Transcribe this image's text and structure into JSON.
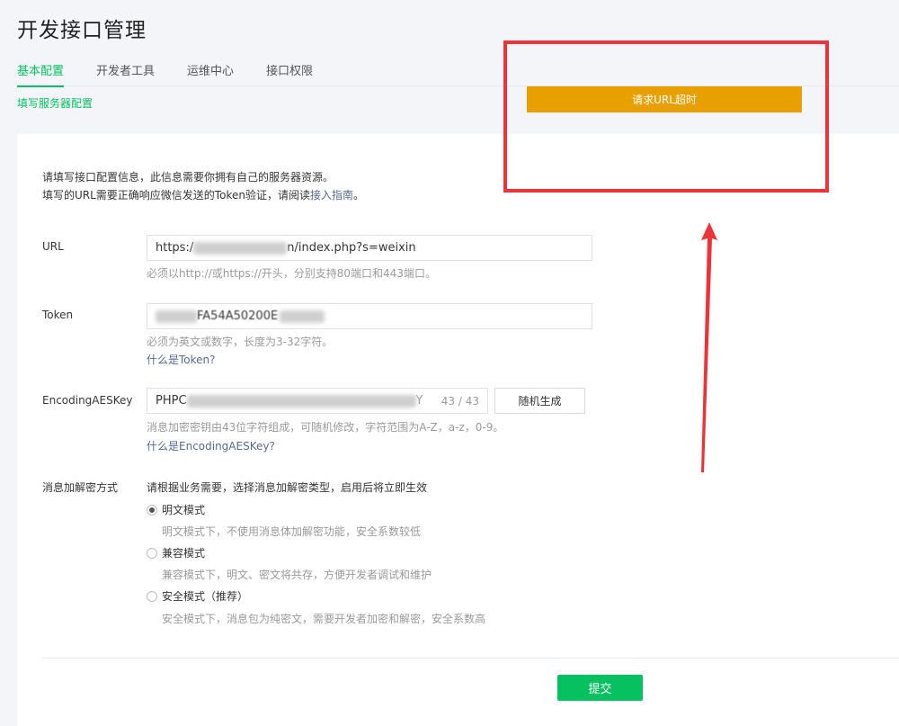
{
  "page": {
    "title": "开发接口管理"
  },
  "tabs": [
    {
      "label": "基本配置",
      "active": true
    },
    {
      "label": "开发者工具",
      "active": false
    },
    {
      "label": "运维中心",
      "active": false
    },
    {
      "label": "接口权限",
      "active": false
    }
  ],
  "sub_link": "填写服务器配置",
  "toast": {
    "text": "请求URL超时",
    "color": "#e8a000"
  },
  "annotation": {
    "color": "#ee3338"
  },
  "intro": {
    "line1": "请填写接口配置信息，此信息需要你拥有自己的服务器资源。",
    "line2_prefix": "填写的URL需要正确响应微信发送的Token验证，请阅读",
    "line2_link": "接入指南",
    "line2_suffix": "。"
  },
  "url": {
    "label": "URL",
    "value_prefix": "https:/",
    "value_suffix": "n/index.php?s=weixin",
    "hint": "必须以http://或https://开头，分别支持80端口和443端口。"
  },
  "token": {
    "label": "Token",
    "value_visible": "FA54A50200E",
    "hint": "必须为英文或数字，长度为3-32字符。",
    "help_link": "什么是Token?"
  },
  "aeskey": {
    "label": "EncodingAESKey",
    "value_prefix": "PHPC",
    "value_suffix": "Y",
    "counter": "43 / 43",
    "generate_button": "随机生成",
    "hint": "消息加密密钥由43位字符组成，可随机修改，字符范围为A-Z，a-z，0-9。",
    "help_link": "什么是EncodingAESKey?"
  },
  "encryption": {
    "label": "消息加解密方式",
    "intro": "请根据业务需要，选择消息加解密类型，启用后将立即生效",
    "options": [
      {
        "label": "明文模式",
        "desc": "明文模式下，不使用消息体加解密功能，安全系数较低",
        "checked": true
      },
      {
        "label": "兼容模式",
        "desc": "兼容模式下，明文、密文将共存，方便开发者调试和维护",
        "checked": false
      },
      {
        "label": "安全模式（推荐）",
        "desc": "安全模式下，消息包为纯密文，需要开发者加密和解密，安全系数高",
        "checked": false
      }
    ]
  },
  "submit_label": "提交",
  "colors": {
    "accent": "#07c160",
    "link": "#576b95"
  }
}
